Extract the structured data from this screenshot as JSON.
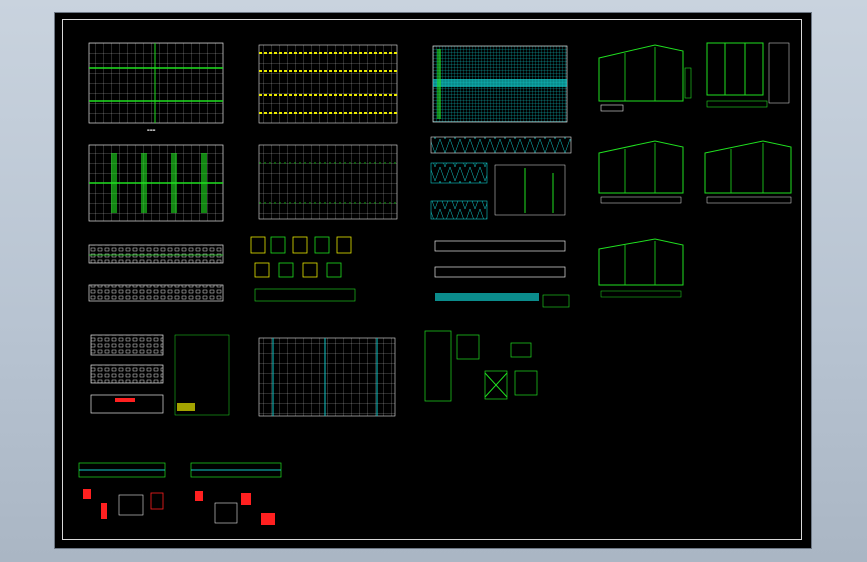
{
  "viewer": {
    "background": "#000000",
    "frame_color": "#d8d8d8"
  },
  "sheets": [
    {
      "id": "plan-1"
    },
    {
      "id": "plan-2"
    },
    {
      "id": "roof-grid"
    },
    {
      "id": "frame-1"
    },
    {
      "id": "frame-2"
    },
    {
      "id": "plan-3"
    },
    {
      "id": "plan-4"
    },
    {
      "id": "truss-elev"
    },
    {
      "id": "frame-3"
    },
    {
      "id": "frame-4"
    },
    {
      "id": "elevations"
    },
    {
      "id": "details-1"
    },
    {
      "id": "beam-elev"
    },
    {
      "id": "frame-5"
    },
    {
      "id": "sections"
    },
    {
      "id": "column-grid"
    },
    {
      "id": "details-2"
    },
    {
      "id": "node-detail-1"
    },
    {
      "id": "node-detail-2"
    }
  ],
  "colors": {
    "green": "#20e020",
    "yellow": "#e8e800",
    "cyan": "#10c8c8",
    "white": "#e6e6e6",
    "red": "#ff2020",
    "magenta": "#ff40ff"
  }
}
